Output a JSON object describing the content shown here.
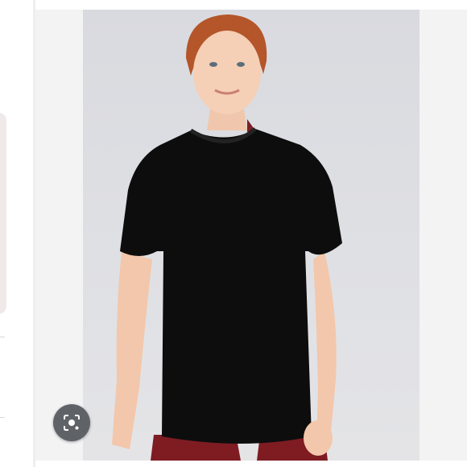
{
  "viewer": {
    "lens_icon": "visual-search-camera-icon",
    "accent_bg": "#5f6368",
    "photo_bg": "#dfe0e4"
  }
}
